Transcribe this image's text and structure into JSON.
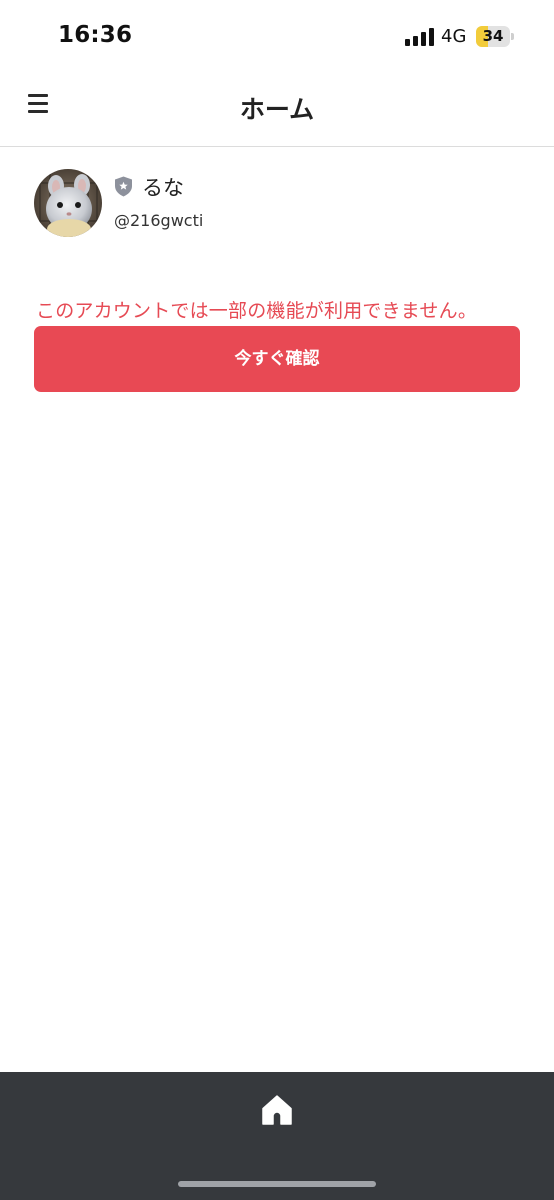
{
  "status_bar": {
    "time": "16:36",
    "network": "4G",
    "battery_level": 34,
    "battery_label": "34",
    "signal_bars": 4,
    "icons": [
      "signal-icon",
      "battery-icon"
    ]
  },
  "header": {
    "title": "ホーム",
    "menu_icon": "hamburger-menu-icon"
  },
  "profile": {
    "name": "るな",
    "handle": "@216gwcti",
    "badge_icon": "shield-star-icon",
    "avatar": "chinchilla-photo"
  },
  "notice": {
    "message": "このアカウントでは一部の機能が利用できません。",
    "button_label": "今すぐ確認"
  },
  "bottom_nav": {
    "home_icon": "home-icon"
  },
  "colors": {
    "accent_red": "#e84954",
    "warning_text": "#e64a54",
    "bottom_bar": "#36393d",
    "battery_yellow": "#f2cc3b"
  }
}
